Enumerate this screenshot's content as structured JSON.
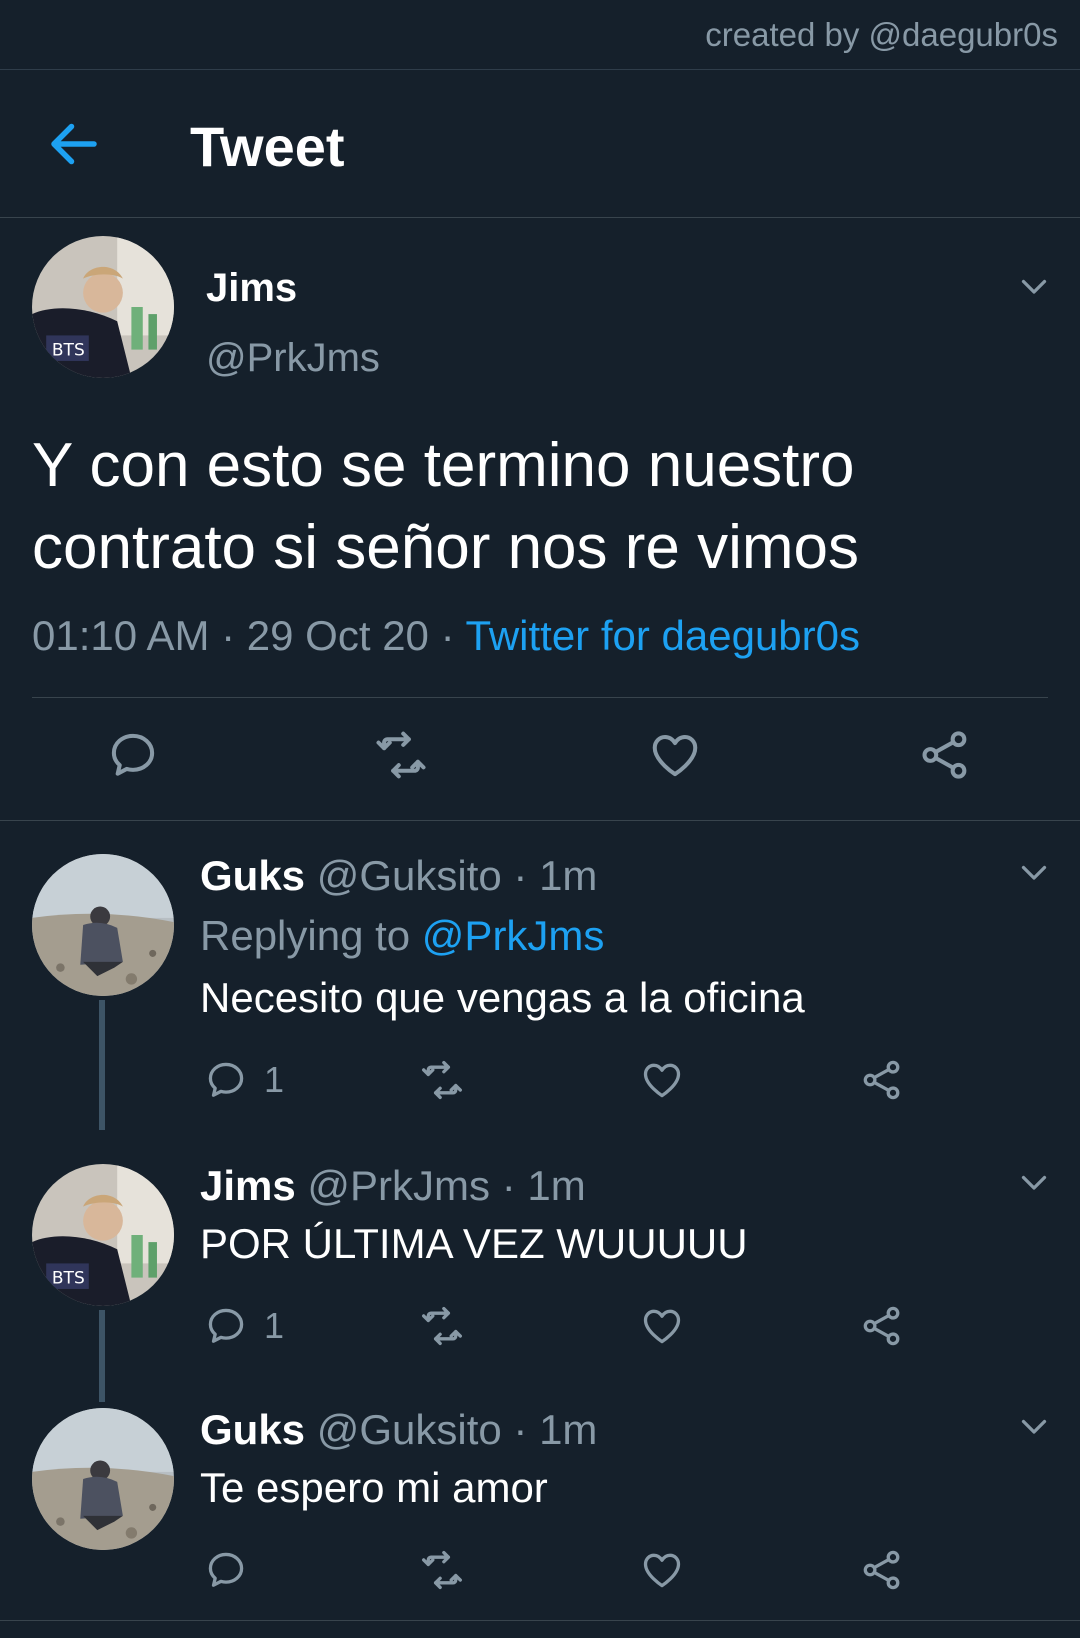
{
  "watermark": "created by @daegubr0s",
  "header": {
    "title": "Tweet",
    "back_icon": "arrow-left-icon"
  },
  "colors": {
    "background": "#15202b",
    "accent": "#1da1f2",
    "secondary_text": "#8899a6",
    "divider": "#38444d"
  },
  "main_tweet": {
    "name": "Jims",
    "handle": "@PrkJms",
    "text": "Y con esto se termino nuestro contrato si señor nos re vimos",
    "time": "01:10 AM",
    "date": "29 Oct 20",
    "source": "Twitter for daegubr0s",
    "separator": " · "
  },
  "replies": [
    {
      "name": "Guks",
      "handle": "@Guksito",
      "time": "· 1m",
      "replying_to_label": "Replying to",
      "replying_to_handle": "@PrkJms",
      "text": "Necesito que vengas a la oficina",
      "reply_count": "1"
    },
    {
      "name": "Jims",
      "handle": "@PrkJms",
      "time": "· 1m",
      "text": "POR ÚLTIMA VEZ WUUUUU",
      "reply_count": "1"
    },
    {
      "name": "Guks",
      "handle": "@Guksito",
      "time": "· 1m",
      "text": "Te espero mi amor",
      "reply_count": ""
    }
  ]
}
